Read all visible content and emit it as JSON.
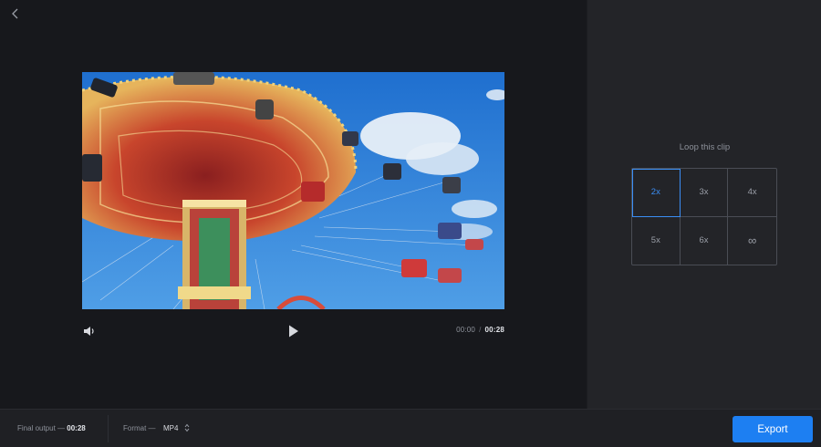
{
  "editor": {
    "back_icon": "chevron-left-icon",
    "video": {
      "description_icon": "swing-ride-photo"
    },
    "controls": {
      "volume_icon": "volume-icon",
      "play_icon": "play-icon",
      "current_time": "00:00",
      "separator": "/",
      "duration": "00:28"
    }
  },
  "side": {
    "loop_title": "Loop this clip",
    "loop_options": [
      "2x",
      "3x",
      "4x",
      "5x",
      "6x",
      "∞"
    ],
    "selected_option": "2x"
  },
  "footer": {
    "final_output_label": "Final output —",
    "final_output_value": "00:28",
    "format_label": "Format —",
    "format_value": "MP4",
    "export_label": "Export"
  },
  "colors": {
    "accent": "#1d7ff2",
    "selected": "#3a8ef5",
    "background": "#17181c",
    "panel": "#232428"
  }
}
